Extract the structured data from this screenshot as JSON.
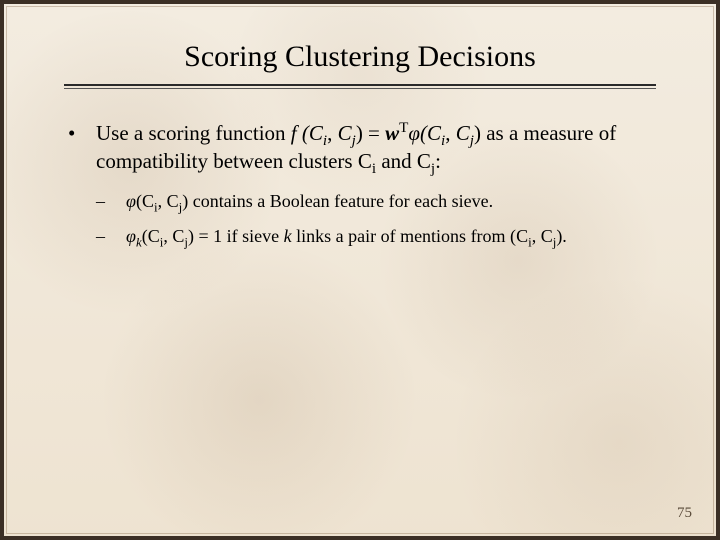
{
  "page_number": "75",
  "title": "Scoring Clustering Decisions",
  "bullet": {
    "marker": "•",
    "pre_text": "Use a scoring function ",
    "post_text_1": " as a measure of compatibility between clusters ",
    "post_text_2": " and ",
    "post_text_3": ":",
    "Ci": "C",
    "Ci_sub": "i",
    "Cj": "C",
    "Cj_sub": "j"
  },
  "formula": {
    "f_open": "f (",
    "comma": ", ",
    "close_eq": ") = ",
    "w": "w",
    "wT": "T",
    "phi_open": "φ(",
    "close": ")",
    "Ci": "C",
    "Ci_sub": "i",
    "Cj": "C",
    "Cj_sub": "j"
  },
  "sub1": {
    "dash": "–",
    "phi": "φ",
    "open": "(",
    "Ci": "C",
    "Ci_sub": "i",
    "comma": ", ",
    "Cj": "C",
    "Cj_sub": "j",
    "close_text": ") contains a Boolean feature for each sieve."
  },
  "sub2": {
    "dash": "–",
    "phi": "φ",
    "phi_sub": "k",
    "open": "(",
    "Ci": "C",
    "Ci_sub": "i",
    "comma": ", ",
    "Cj": "C",
    "Cj_sub": "j",
    "mid_text": ") = 1 if sieve ",
    "k": "k",
    "tail_text": " links a pair of mentions from (",
    "Ci2": "C",
    "Ci2_sub": "i",
    "comma2": ", ",
    "Cj2": "C",
    "Cj2_sub": "j",
    "end": ")."
  }
}
